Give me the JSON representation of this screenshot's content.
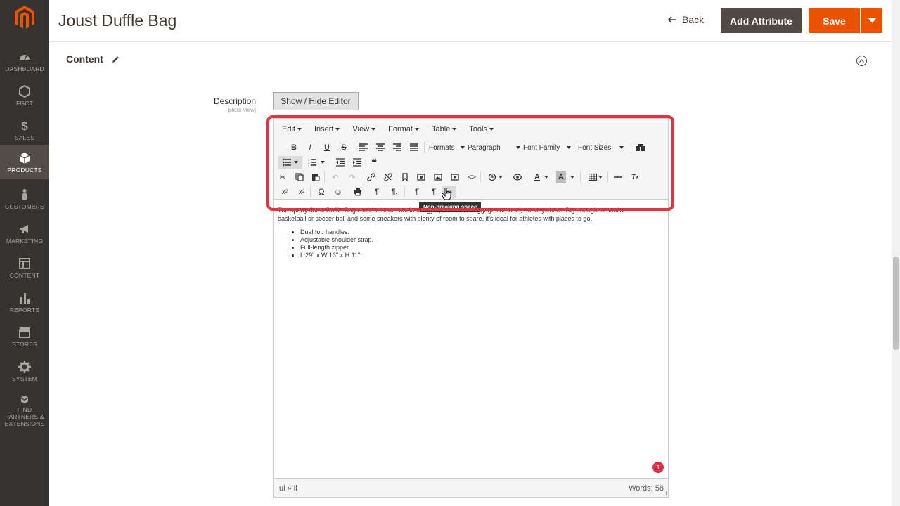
{
  "app": {
    "logo_icon": "magento-logo-icon",
    "brand_color": "#eb5202"
  },
  "sidebar": {
    "items": [
      {
        "label": "DASHBOARD",
        "icon": "dashboard-icon"
      },
      {
        "label": "FGCT",
        "icon": "hexagon-icon"
      },
      {
        "label": "SALES",
        "icon": "dollar-icon"
      },
      {
        "label": "PRODUCTS",
        "icon": "cube-icon",
        "active": true
      },
      {
        "label": "CUSTOMERS",
        "icon": "person-icon"
      },
      {
        "label": "MARKETING",
        "icon": "megaphone-icon"
      },
      {
        "label": "CONTENT",
        "icon": "layout-icon"
      },
      {
        "label": "REPORTS",
        "icon": "bar-chart-icon"
      },
      {
        "label": "STORES",
        "icon": "storefront-icon"
      },
      {
        "label": "SYSTEM",
        "icon": "gear-icon"
      },
      {
        "label": "FIND PARTNERS & EXTENSIONS",
        "icon": "box-stack-icon"
      }
    ]
  },
  "header": {
    "title": "Joust Duffle Bag",
    "back_label": "Back",
    "add_attribute_label": "Add Attribute",
    "save_label": "Save"
  },
  "section": {
    "title": "Content"
  },
  "field": {
    "label": "Description",
    "scope": "[store view]",
    "toggle_label": "Show / Hide Editor"
  },
  "editor": {
    "menus": [
      "Edit",
      "Insert",
      "View",
      "Format",
      "Table",
      "Tools"
    ],
    "selects": {
      "formats": "Formats",
      "block": "Paragraph",
      "font_family": "Font Family",
      "font_sizes": "Font Sizes"
    },
    "body_text_1": "The sporty Joust Duffle Bag can't be beat - not in the gym, not on the luggage carousel, not anywhere. Big enough to haul a",
    "body_text_2": "basketball or soccer ball and some sneakers with plenty of room to spare, it's ideal for athletes with places to go.",
    "bullets": [
      "Dual top handles.",
      "Adjustable shoulder strap.",
      "Full-length zipper.",
      "L 29\" x W 13\" x H 11\"."
    ],
    "path": "ul » li",
    "words": "Words: 58",
    "badge_count": "1",
    "tooltip": "Non-breaking space"
  }
}
